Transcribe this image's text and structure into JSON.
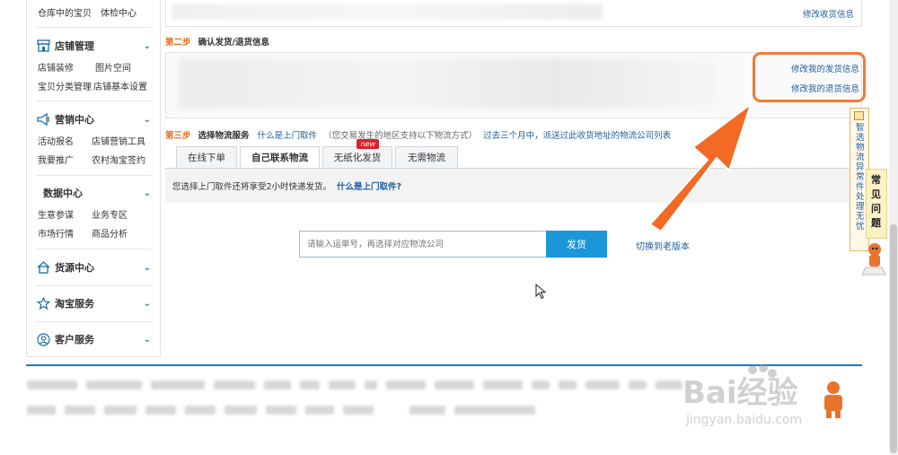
{
  "sidebar": {
    "warehouse_row": [
      "仓库中的宝贝",
      "体检中心"
    ],
    "shop": {
      "title": "店铺管理",
      "rows": [
        [
          "店铺装修",
          "图片空间"
        ],
        [
          "宝贝分类管理",
          "店铺基本设置"
        ]
      ]
    },
    "marketing": {
      "title": "营销中心",
      "rows": [
        [
          "活动报名",
          "店铺营销工具"
        ],
        [
          "我要推广",
          "农村淘宝签约"
        ]
      ]
    },
    "data": {
      "title": "数据中心",
      "rows": [
        [
          "生意参谋",
          "业务专区"
        ],
        [
          "市场行情",
          "商品分析"
        ]
      ]
    },
    "source": {
      "title": "货源中心"
    },
    "taobao": {
      "title": "淘宝服务"
    },
    "customer": {
      "title": "客户服务"
    }
  },
  "main": {
    "edit_receive_link": "修改收货信息",
    "step2": {
      "num": "第二步",
      "title": "确认发货/退货信息"
    },
    "edit_ship_link": "修改我的发货信息",
    "edit_return_link": "修改我的退货信息",
    "step3": {
      "num": "第三步",
      "title": "选择物流服务",
      "pickup_link": "什么是上门取件",
      "note": "（您交易发生的地区支持以下物流方式）",
      "history_link": "过去三个月中，派送过此收货地址的物流公司列表"
    },
    "tabs": [
      {
        "label": "在线下单"
      },
      {
        "label": "自己联系物流"
      },
      {
        "label": "无纸化发货",
        "badge": "new"
      },
      {
        "label": "无需物流"
      }
    ],
    "notice": {
      "text": "您选择上门取件还将享受2小时快递发货。",
      "link": "什么是上门取件?"
    },
    "tracking_placeholder": "请输入运单号，再选择对应物流公司",
    "ship_button": "发货",
    "old_version_link": "切换到老版本"
  },
  "side": {
    "logistics_vertical": "智选物流异常件处理无忧",
    "faq_vertical": "常见问题"
  },
  "watermark": {
    "brand": "Bai经验",
    "url": "jingyan.baidu.com"
  },
  "colors": {
    "accent": "#1b96d8",
    "highlight": "#f07a38",
    "step": "#e86c1a",
    "link": "#1d5fa0"
  }
}
